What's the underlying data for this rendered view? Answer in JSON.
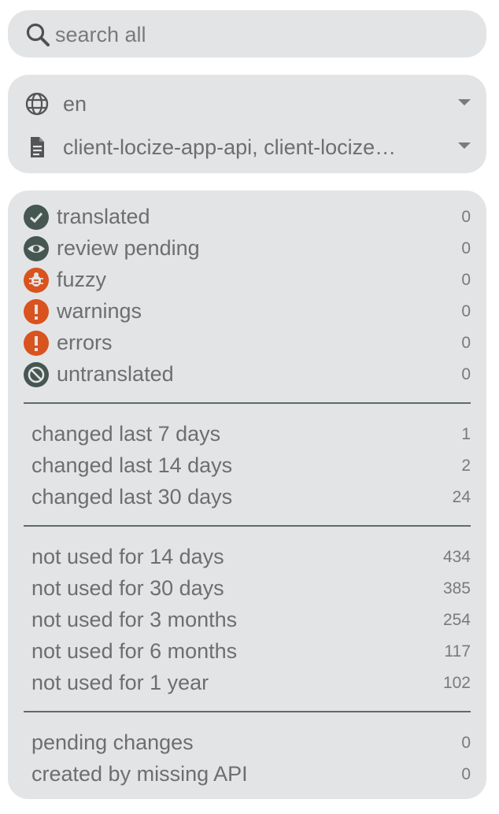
{
  "search": {
    "placeholder": "search all",
    "icon": "search-icon"
  },
  "selectors": {
    "language": {
      "value": "en",
      "icon": "globe-icon"
    },
    "namespace": {
      "value": "client-locize-app-api, client-locize…",
      "icon": "document-icon"
    }
  },
  "status_filters": [
    {
      "label": "translated",
      "count": "0",
      "icon": "check-circle-icon",
      "color": "#465650"
    },
    {
      "label": "review pending",
      "count": "0",
      "icon": "eye-icon",
      "color": "#465650"
    },
    {
      "label": "fuzzy",
      "count": "0",
      "icon": "bug-icon",
      "color": "#d9531e"
    },
    {
      "label": "warnings",
      "count": "0",
      "icon": "exclamation-icon",
      "color": "#d9531e"
    },
    {
      "label": "errors",
      "count": "0",
      "icon": "exclamation-icon",
      "color": "#d9531e"
    },
    {
      "label": "untranslated",
      "count": "0",
      "icon": "block-icon",
      "color": "#465650"
    }
  ],
  "changed_filters": [
    {
      "label": "changed last 7 days",
      "count": "1"
    },
    {
      "label": "changed last 14 days",
      "count": "2"
    },
    {
      "label": "changed last 30 days",
      "count": "24"
    }
  ],
  "unused_filters": [
    {
      "label": "not used for 14 days",
      "count": "434"
    },
    {
      "label": "not used for 30 days",
      "count": "385"
    },
    {
      "label": "not used for 3 months",
      "count": "254"
    },
    {
      "label": "not used for 6 months",
      "count": "117"
    },
    {
      "label": "not used for 1 year",
      "count": "102"
    }
  ],
  "other_filters": [
    {
      "label": "pending changes",
      "count": "0"
    },
    {
      "label": "created by missing API",
      "count": "0"
    }
  ]
}
